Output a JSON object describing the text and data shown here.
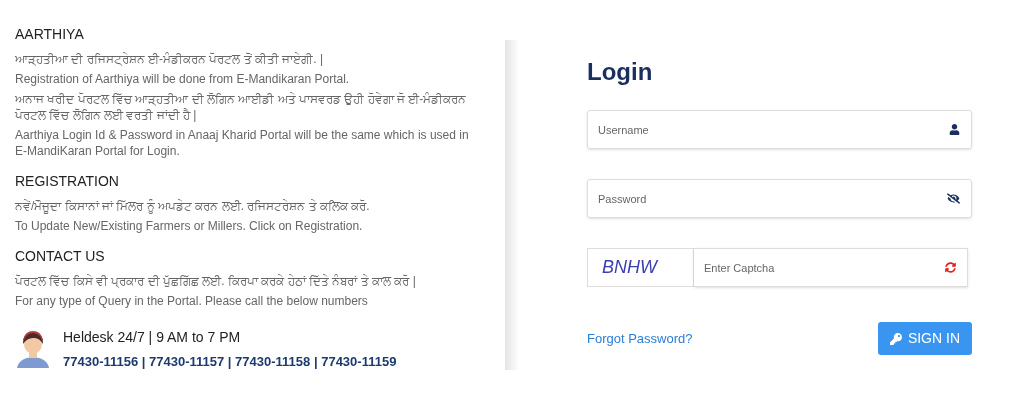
{
  "sections": [
    {
      "heading": "AARTHIYA",
      "lines": [
        "ਆੜ੍ਹਤੀਆ ਦੀ ਰਜਿਸਟ੍ਰੇਸ਼ਨ ਈ-ਮੰਡੀਕਰਨ ਪੋਰਟਲ ਤੋਂ ਕੀਤੀ ਜਾਏਗੀ. |",
        "Registration of Aarthiya will be done from E-Mandikaran Portal.",
        "ਅਨਾਜ ਖਰੀਦ ਪੋਰਟਲ ਵਿੱਚ ਆੜ੍ਹਤੀਆ ਦੀ ਲੋਗਿਨ ਆਈਡੀ ਅਤੇ ਪਾਸਵਰਡ ਉਹੀ ਹੋਵੇਗਾ ਜੋ ਈ-ਮੰਡੀਕਰਨ ਪੋਰਟਲ ਵਿੱਚ ਲੋਗਿਨ ਲਈ ਵਰਤੀ ਜਾਂਦੀ ਹੈ |",
        "Aarthiya Login Id & Password in Anaaj Kharid Portal will be the same which is used in E-MandiKaran Portal for Login."
      ]
    },
    {
      "heading": "REGISTRATION",
      "lines": [
        "ਨਵੇਂ/ਮੌਜੂਦਾ ਕਿਸਾਨਾਂ ਜਾਂ ਮਿੱਲਰ ਨੂੰ ਅਪਡੇਟ ਕਰਨ ਲਈ. ਰਜਿਸਟਰੇਸ਼ਨ ਤੇ ਕਲਿਕ ਕਰੋ.",
        "To Update New/Existing Farmers or Millers. Click on Registration."
      ]
    },
    {
      "heading": "CONTACT US",
      "lines": [
        "ਪੋਰਟਲ ਵਿੱਚ ਕਿਸੇ ਵੀ ਪ੍ਰਕਾਰ ਦੀ ਪੁੱਛਗਿੱਛ ਲਈ. ਕਿਰਪਾ ਕਰਕੇ ਹੇਠਾਂ ਦਿੱਤੇ ਨੰਬਰਾਂ ਤੇ ਕਾਲ ਕਰੋ |",
        "For any type of Query in the Portal. Please call the below numbers"
      ]
    }
  ],
  "helpdesk": {
    "hours": "Heldesk 24/7 | 9 AM to 7 PM",
    "numbers": "77430-11156 | 77430-11157 | 77430-11158 | 77430-11159"
  },
  "login": {
    "title": "Login",
    "username": {
      "placeholder": "Username"
    },
    "password": {
      "placeholder": "Password"
    },
    "captcha": {
      "code": "BNHW",
      "placeholder": "Enter Captcha"
    },
    "forgot": "Forgot Password?",
    "submit": "SIGN IN"
  }
}
